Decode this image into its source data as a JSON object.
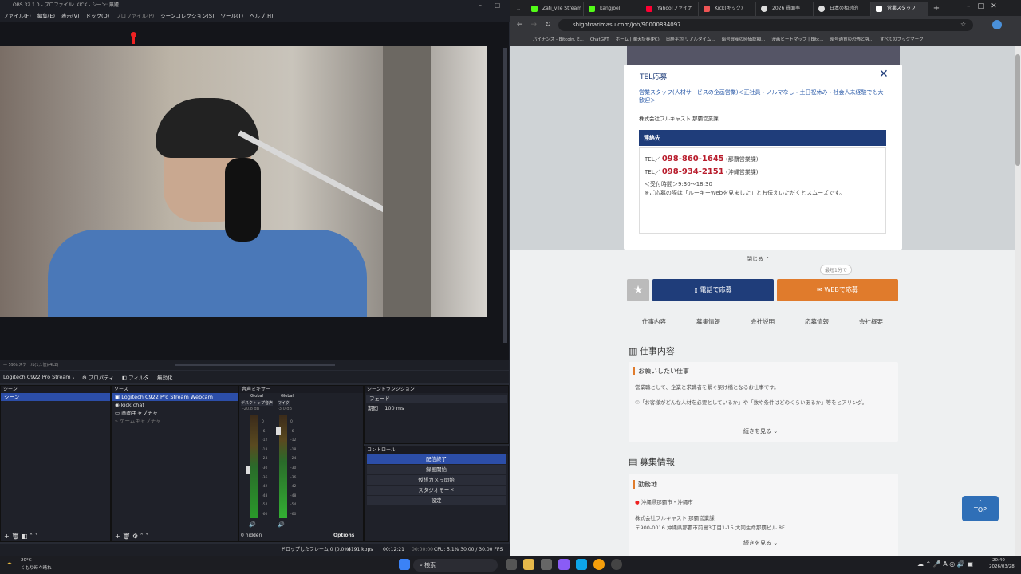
{
  "obs": {
    "title": "OBS 32.1.0 - プロファイル: KICK - シーン: 無題",
    "menu": [
      "ファイル(F)",
      "編集(E)",
      "表示(V)",
      "ドック(D)",
      "プロファイル(P)",
      "シーンコレクション(S)",
      "ツール(T)",
      "ヘルプ(H)"
    ],
    "status_small": "— 59%   スケール(1,1倍)(4k2)",
    "source_name": "Logitech C922 Pro Stream \\",
    "props_label": "プロパティ",
    "filter_label": "フィルタ",
    "disable_label": "無効化",
    "docks": {
      "scenes": "シーン",
      "sources": "ソース",
      "mixer": "音声ミキサー",
      "transitions": "シーントランジション",
      "controls": "コントロール"
    },
    "scenes": [
      "シーン"
    ],
    "sources": [
      "Logitech C922 Pro Stream Webcam",
      "kick chat",
      "画面キャプチャ",
      "ゲームキャプチャ"
    ],
    "mixer": {
      "global1": "Global",
      "global2": "Global",
      "ch1": "デスクトップ音声",
      "ch2": "マイク",
      "db1": "-20.8 dB",
      "db2": "-3.0 dB",
      "scale": [
        "0",
        "-6",
        "-12",
        "-18",
        "-24",
        "-30",
        "-36",
        "-42",
        "-48",
        "-54",
        "-60"
      ],
      "hidden": "0 hidden",
      "options": "Options"
    },
    "transition": {
      "type": "フェード",
      "duration_label": "期間",
      "duration": "100 ms"
    },
    "controls": [
      "配信終了",
      "録画開始",
      "仮想カメラ開始",
      "スタジオモード",
      "設定"
    ],
    "bottom": {
      "dropped": "ドロップしたフレーム 0 (0.0%)",
      "kbps": "6191 kbps",
      "time1": "00:12:21",
      "time2": "00:00:00",
      "cpu": "CPU: 5.1% 30.00 / 30.00 FPS"
    }
  },
  "chrome": {
    "tabs": [
      "Zati_vile Stream",
      "kangjoel",
      "Yahoo!ファイナ",
      "Kick(キック)",
      "2026 賃面率",
      "日本の相対的",
      "営業スタッフ"
    ],
    "url": "shigotoarimasu.com/job/90000834097",
    "bookmarks": [
      "バイナンス - Bitcoin, E...",
      "ChatGPT",
      "ホーム | 楽天証券(PC)",
      "日経平均 リアルタイム...",
      "暗号資産の時価総額...",
      "漫画ヒートマップ | Bitc...",
      "暗号通貨の恐怖と強...",
      "すべてのブックマーク"
    ]
  },
  "modal": {
    "title": "TEL応募",
    "job": "営業スタッフ(人材サービスの企画営業)＜正社員・ノルマなし・土日祝休み・社会人未経験でも大歓迎＞",
    "company": "株式会社フルキャスト 那覇営業課",
    "contact_head": "連絡先",
    "tel_label1": "TEL／",
    "tel1": "098-860-1645",
    "tel1_note": "(那覇営業課)",
    "tel_label2": "TEL／",
    "tel2": "098-934-2151",
    "tel2_note": "(沖縄営業課)",
    "hours": "＜受付時間＞9:30〜18:30",
    "note": "※ご応募の際は「ルーキーWebを見ました」とお伝えいただくとスムーズです。"
  },
  "page": {
    "close_more": "閉じる",
    "bubble": "最短1分で",
    "tel_apply": "電話で応募",
    "web_apply": "WEBで応募",
    "nav": [
      "仕事内容",
      "募集情報",
      "会社説明",
      "応募情報",
      "会社概要"
    ],
    "sec1": "仕事内容",
    "req_head": "お願いしたい仕事",
    "req_p1": "営業職として、企業と求職者を繋ぐ架け橋となるお仕事です。",
    "req_p2": "①「お客様がどんな人材を必要としているか」や「数や条件はどのくらいあるか」等をヒアリング。",
    "more1": "続きを見る",
    "sec2": "募集情報",
    "loc_head": "勤務地",
    "loc1": "沖縄県那覇市・沖縄市",
    "loc2": "株式会社フルキャスト 那覇営業課",
    "loc3": "〒900-0016 沖縄県那覇市前島3丁目1-15 大同生命那覇ビル 8F",
    "more2": "続きを見る",
    "top": "TOP"
  },
  "taskbar": {
    "weather_temp": "20°C",
    "weather_text": "くもり時々晴れ",
    "search": "検索",
    "time": "20:40",
    "date": "2026/03/28"
  }
}
